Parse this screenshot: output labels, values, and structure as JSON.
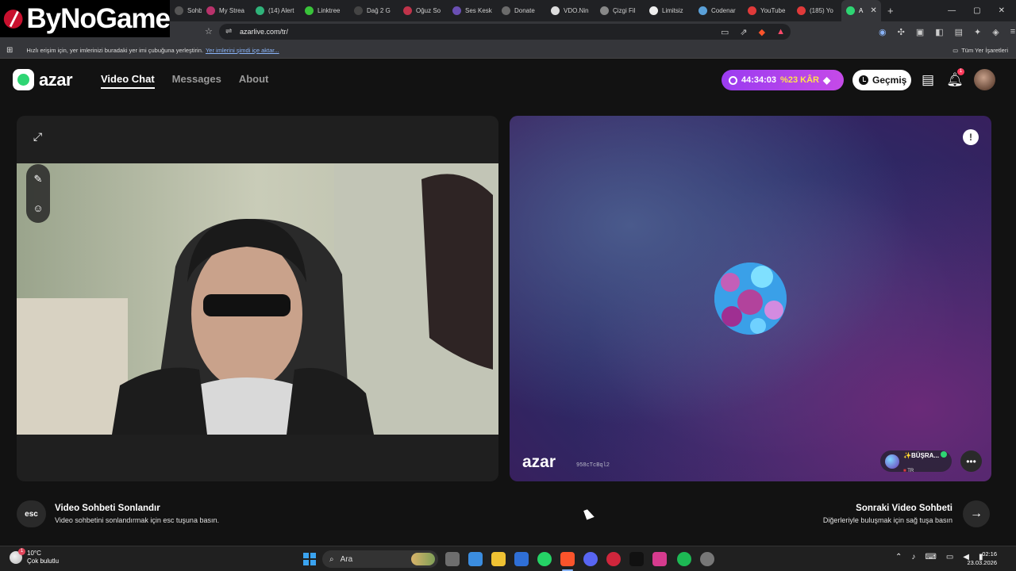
{
  "brand_overlay": {
    "text": "ByNoGame"
  },
  "browser": {
    "tabs": [
      {
        "label": "Sohbet",
        "color": "#555555"
      },
      {
        "label": "My Strea",
        "color": "#b8326b"
      },
      {
        "label": "(14) Alert",
        "color": "#2fb37a"
      },
      {
        "label": "Linktree",
        "color": "#39c33a"
      },
      {
        "label": "Dağ 2 G",
        "color": "#444444"
      },
      {
        "label": "Oğuz So",
        "color": "#c0334a"
      },
      {
        "label": "Ses Kesk",
        "color": "#6a4fb3"
      },
      {
        "label": "Donate",
        "color": "#6b6b6b"
      },
      {
        "label": "VDO.Nin",
        "color": "#dddddd"
      },
      {
        "label": "Çizgi Fil",
        "color": "#888888"
      },
      {
        "label": "Limitsiz",
        "color": "#eeeeee"
      },
      {
        "label": "Codenar",
        "color": "#5aa0d8"
      },
      {
        "label": "YouTube",
        "color": "#e03a3a"
      },
      {
        "label": "(185) Yo",
        "color": "#e03a3a"
      },
      {
        "label": "A",
        "color": "#2ed573",
        "active": true
      }
    ],
    "url": "azarlive.com/tr/",
    "bookmark_hint": "Hızlı erişim için, yer imlerinizi buradaki yer imi çubuğuna yerleştirin.",
    "bookmark_link": "Yer imlerini şimdi içe aktar...",
    "all_bookmarks": "Tüm Yer İşaretleri"
  },
  "header": {
    "logo_text": "azar",
    "nav": [
      "Video Chat",
      "Messages",
      "About"
    ],
    "promo_timer": "44:34:03",
    "promo_discount": "%23 KÂR",
    "history_label": "Geçmiş",
    "notif_count": "1"
  },
  "peer": {
    "watermark": "azar",
    "id": "958cTcBql2",
    "name": "✨BÜŞRA...",
    "country": "TR"
  },
  "controls": {
    "esc_label": "esc",
    "end_title": "Video Sohbeti Sonlandır",
    "end_sub": "Video sohbetini sonlandırmak için esc tuşuna basın.",
    "next_title": "Sonraki Video Sohbeti",
    "next_sub": "Diğerleriyle buluşmak için sağ tuşa basın"
  },
  "taskbar": {
    "temp": "10°C",
    "weather": "Çok bulutlu",
    "search": "Ara",
    "time": "02:16",
    "date": "23.03.2026"
  }
}
